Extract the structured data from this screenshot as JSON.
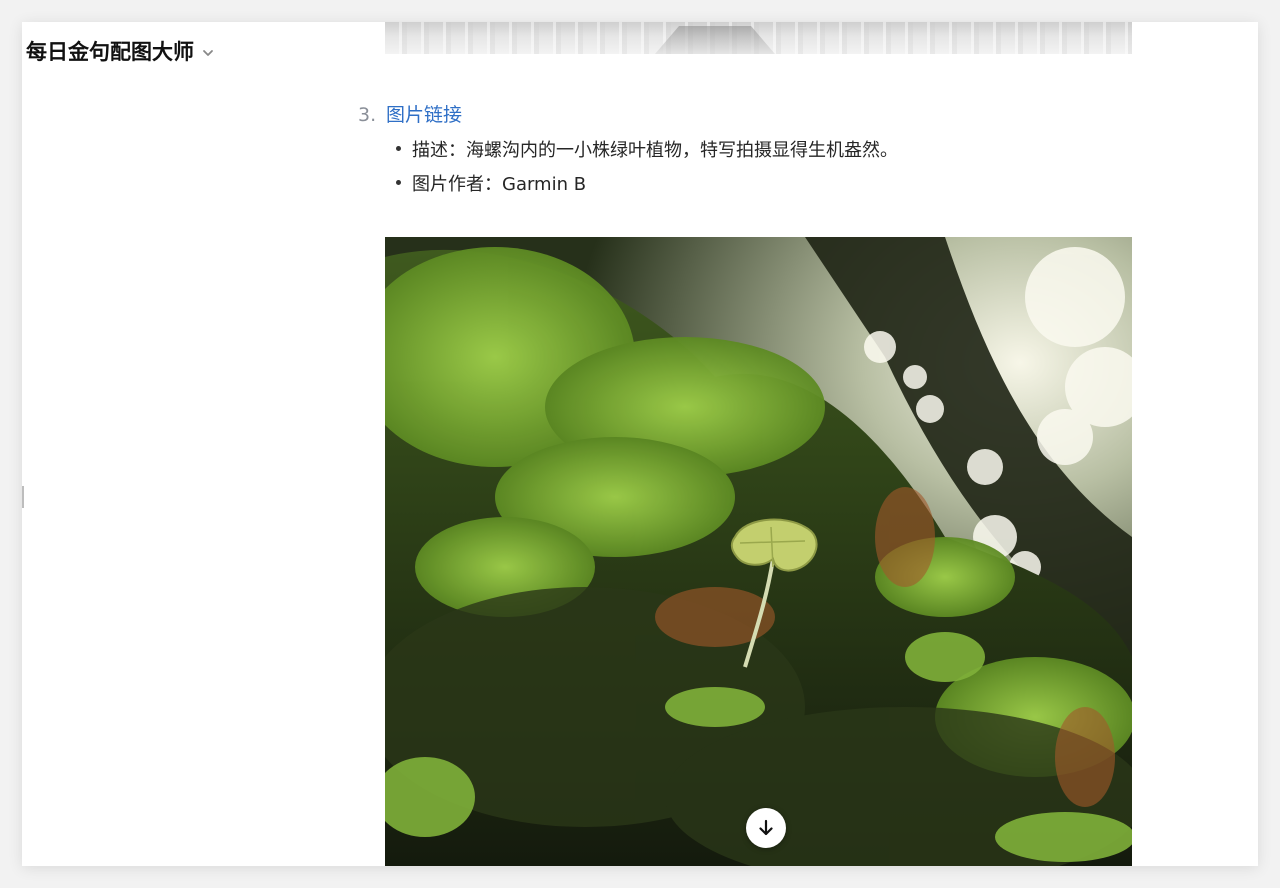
{
  "header": {
    "title": "每日金句配图大师",
    "dropdown_icon": "chevron-down-icon"
  },
  "content": {
    "item": {
      "number": "3.",
      "link_text": "图片链接",
      "bullets": [
        "描述：海螺沟内的一小株绿叶植物，特写拍摄显得生机盎然。",
        "图片作者：Garmin B"
      ]
    },
    "scroll_button_icon": "arrow-down-icon"
  },
  "colors": {
    "link": "#2f6fc6",
    "text": "#262626",
    "muted": "#8a8f98"
  }
}
